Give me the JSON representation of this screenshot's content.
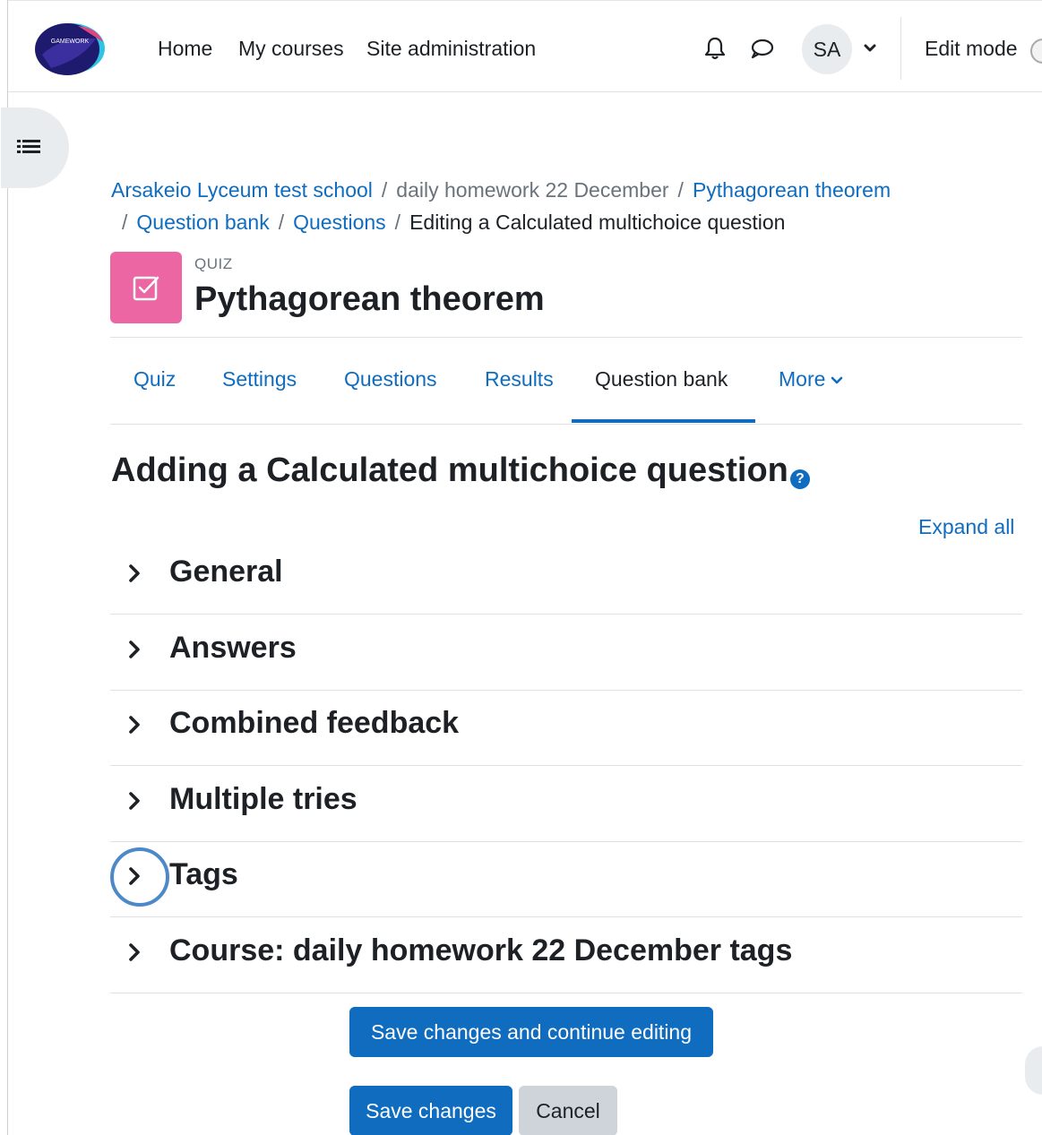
{
  "navbar": {
    "logo_text": "GAMEWORK",
    "links": [
      "Home",
      "My courses",
      "Site administration"
    ],
    "notifications_icon": "bell-icon",
    "messages_icon": "chat-bubble-icon",
    "avatar_initials": "SA",
    "edit_mode_label": "Edit mode"
  },
  "breadcrumb": {
    "items": [
      {
        "label": "Arsakeio Lyceum test school",
        "link": true
      },
      {
        "label": "daily homework 22 December",
        "link": false
      },
      {
        "label": "Pythagorean theorem",
        "link": true
      },
      {
        "label": "Question bank",
        "link": true
      },
      {
        "label": "Questions",
        "link": true
      },
      {
        "label": "Editing a Calculated multichoice question",
        "link": false
      }
    ]
  },
  "header": {
    "activity_type": "QUIZ",
    "title": "Pythagorean theorem",
    "icon": "quiz-checkbox-icon",
    "icon_color": "#eb66a2"
  },
  "tabs": {
    "items": [
      "Quiz",
      "Settings",
      "Questions",
      "Results",
      "Question bank",
      "More"
    ],
    "active": "Question bank"
  },
  "main": {
    "heading": "Adding a Calculated multichoice question",
    "help_icon": "question-circle-icon",
    "expand_all": "Expand all",
    "sections": [
      "General",
      "Answers",
      "Combined feedback",
      "Multiple tries",
      "Tags",
      "Course: daily homework 22 December tags"
    ],
    "focused_section": "Tags"
  },
  "buttons": {
    "save_continue": "Save changes and continue editing",
    "save": "Save changes",
    "cancel": "Cancel"
  },
  "colors": {
    "primary": "#0f6cbf",
    "text": "#1d2125",
    "muted": "#6a737b",
    "quiz_icon_bg": "#eb66a2"
  }
}
